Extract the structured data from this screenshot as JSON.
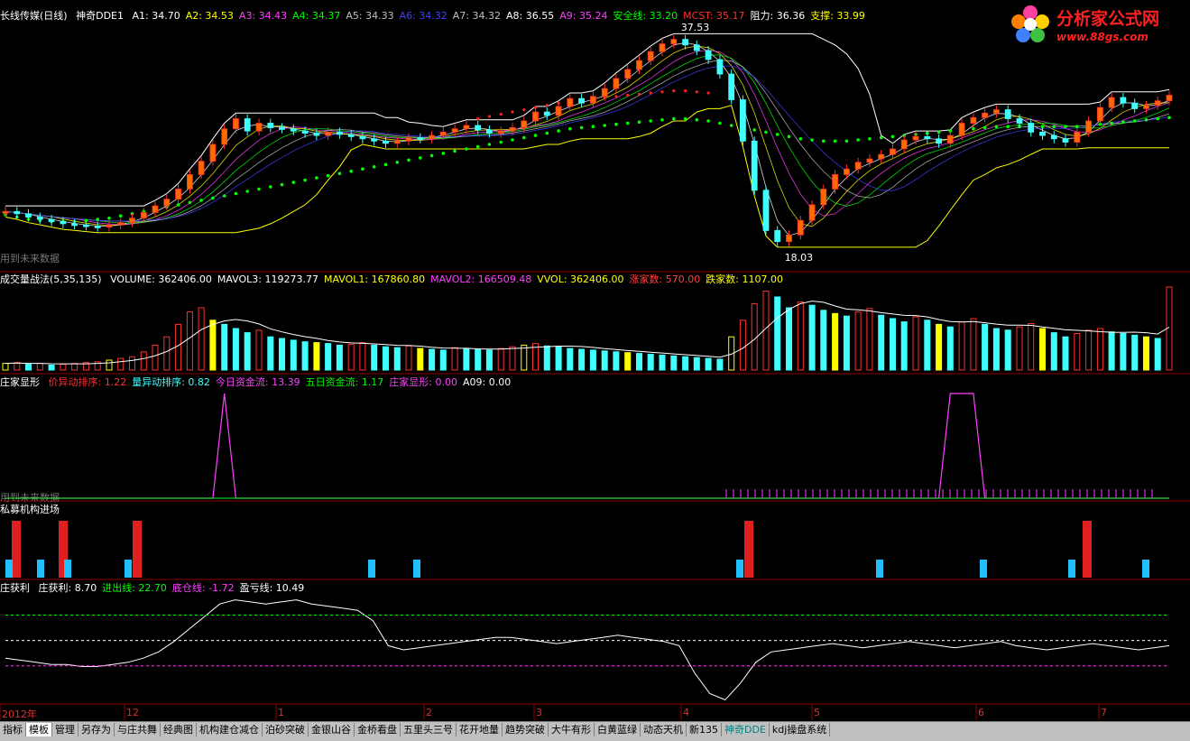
{
  "header": {
    "stock_name": "长线传媒(日线)",
    "indicator_name": "神奇DDE1",
    "items": [
      {
        "label": "A1: 34.70",
        "color": "#ffffff"
      },
      {
        "label": "A2: 34.53",
        "color": "#ffff00"
      },
      {
        "label": "A3: 34.43",
        "color": "#ff40ff"
      },
      {
        "label": "A4: 34.37",
        "color": "#00ff00"
      },
      {
        "label": "A5: 34.33",
        "color": "#c0c0c0"
      },
      {
        "label": "A6: 34.32",
        "color": "#4040ff"
      },
      {
        "label": "A7: 34.32",
        "color": "#c0c0c0"
      },
      {
        "label": "A8: 36.55",
        "color": "#ffffff"
      },
      {
        "label": "A9: 35.24",
        "color": "#ff40ff"
      },
      {
        "label": "安全线: 33.20",
        "color": "#00ff00"
      },
      {
        "label": "MCST: 35.17",
        "color": "#ff3030"
      },
      {
        "label": "阻力: 36.36",
        "color": "#ffffff"
      },
      {
        "label": "支撑: 33.99",
        "color": "#ffff00"
      }
    ]
  },
  "volume_header": {
    "title": "成交量战法(5,35,135)",
    "items": [
      {
        "label": "VOLUME: 362406.00",
        "color": "#ffffff"
      },
      {
        "label": "MAVOL3: 119273.77",
        "color": "#ffffff"
      },
      {
        "label": "MAVOL1: 167860.80",
        "color": "#ffff00"
      },
      {
        "label": "MAVOL2: 166509.48",
        "color": "#ff40ff"
      },
      {
        "label": "VVOL: 362406.00",
        "color": "#ffff00"
      },
      {
        "label": "涨家数: 570.00",
        "color": "#ff4040"
      },
      {
        "label": "跌家数: 1107.00",
        "color": "#ffff00"
      }
    ]
  },
  "dealer_header": {
    "title": "庄家显形",
    "items": [
      {
        "label": "价异动排序: 1.22",
        "color": "#ff3030"
      },
      {
        "label": "量异动排序: 0.82",
        "color": "#40ffff"
      },
      {
        "label": "今日资金流: 13.39",
        "color": "#ff40ff"
      },
      {
        "label": "五日资金流: 1.17",
        "color": "#00ff00"
      },
      {
        "label": "庄家显形: 0.00",
        "color": "#ff40ff"
      },
      {
        "label": "A09: 0.00",
        "color": "#ffffff"
      }
    ]
  },
  "fund_header": {
    "title": "私募机构进场"
  },
  "profit_header": {
    "title": "庄获利",
    "items": [
      {
        "label": "庄获利: 8.70",
        "color": "#ffffff"
      },
      {
        "label": "进出线: 22.70",
        "color": "#00ff00"
      },
      {
        "label": "底仓线: -1.72",
        "color": "#ff40ff"
      },
      {
        "label": "盈亏线: 10.49",
        "color": "#ffffff"
      }
    ]
  },
  "future_note": "用到未来数据",
  "price_labels": {
    "high": "37.53",
    "low": "18.03"
  },
  "time_axis": [
    "2012年",
    "12",
    "1",
    "2",
    "3",
    "4",
    "5",
    "6",
    "7"
  ],
  "watermark": {
    "title": "分析家公式网",
    "url": "www.88gs.com"
  },
  "tabs": [
    {
      "label": "指标",
      "active": false
    },
    {
      "label": "模板",
      "active": true
    },
    {
      "label": "管理",
      "active": false
    },
    {
      "label": "另存为",
      "active": false
    },
    {
      "label": "与庄共舞",
      "active": false
    },
    {
      "label": "经典图",
      "active": false
    },
    {
      "label": "机构建仓减仓",
      "active": false
    },
    {
      "label": "泊砂突破",
      "active": false
    },
    {
      "label": "金银山谷",
      "active": false
    },
    {
      "label": "金桥看盘",
      "active": false
    },
    {
      "label": "五里头三号",
      "active": false
    },
    {
      "label": "花开地量",
      "active": false
    },
    {
      "label": "趋势突破",
      "active": false
    },
    {
      "label": "大牛有形",
      "active": false
    },
    {
      "label": "白黄蓝绿",
      "active": false
    },
    {
      "label": "动态天机",
      "active": false
    },
    {
      "label": "新135",
      "active": false
    },
    {
      "label": "神奇DDE",
      "active": false,
      "teal": true
    },
    {
      "label": "kdj操盘系统",
      "active": false
    }
  ],
  "colors": {
    "up": "#ff3030",
    "down": "#40ffff",
    "ma": "#ffffff",
    "support": "#ffff00",
    "safe_dots": "#00ff00",
    "mcst_dots": "#ff2020",
    "separator": "#8b0000"
  },
  "chart_data": [
    {
      "type": "candlestick",
      "title": "长线传媒(日线) 神奇DDE1",
      "ylim": [
        17,
        38
      ],
      "annotations": [
        "37.53",
        "18.03"
      ],
      "series": [
        {
          "name": "close",
          "values": [
            21.5,
            21.3,
            21.0,
            20.8,
            20.6,
            20.4,
            20.3,
            20.2,
            20.1,
            20.3,
            20.5,
            20.9,
            21.4,
            22.0,
            22.6,
            23.5,
            24.8,
            26.0,
            27.5,
            28.9,
            29.8,
            28.7,
            29.4,
            29.0,
            28.9,
            28.7,
            28.5,
            28.3,
            28.6,
            28.4,
            28.2,
            28.0,
            27.8,
            27.6,
            27.8,
            28.1,
            28.0,
            28.3,
            28.6,
            28.9,
            29.2,
            28.8,
            28.5,
            28.7,
            29.0,
            29.6,
            30.4,
            30.1,
            30.9,
            31.6,
            31.2,
            31.8,
            32.5,
            33.4,
            34.2,
            35.0,
            35.8,
            36.5,
            36.9,
            36.4,
            35.9,
            35.1,
            33.8,
            31.5,
            27.8,
            23.4,
            19.8,
            18.8,
            19.4,
            20.7,
            22.1,
            23.5,
            24.8,
            25.3,
            25.9,
            26.2,
            26.6,
            27.1,
            27.9,
            28.2,
            28.0,
            27.6,
            28.3,
            29.4,
            29.9,
            30.3,
            30.6,
            29.8,
            29.4,
            28.6,
            28.3,
            28.0,
            27.7,
            28.6,
            29.6,
            30.8,
            31.7,
            31.2,
            30.7,
            31.0,
            31.4,
            31.9
          ]
        },
        {
          "name": "安全线",
          "values": [
            21.2,
            21.0,
            20.8,
            20.7,
            20.6,
            20.6,
            20.6,
            20.7,
            20.8,
            20.9,
            21.1,
            21.3,
            21.5,
            21.7,
            21.9,
            22.1,
            22.3,
            22.5,
            22.7,
            22.9,
            23.1,
            23.3,
            23.5,
            23.7,
            23.9,
            24.1,
            24.3,
            24.5,
            24.7,
            24.9,
            25.1,
            25.3,
            25.5,
            25.7,
            25.9,
            26.1,
            26.3,
            26.5,
            26.7,
            26.9,
            27.1,
            27.3,
            27.5,
            27.7,
            27.9,
            28.1,
            28.3,
            28.5,
            28.7,
            28.9,
            29.0,
            29.1,
            29.2,
            29.3,
            29.4,
            29.5,
            29.6,
            29.7,
            29.8,
            29.8,
            29.7,
            29.6,
            29.4,
            29.2,
            29.0,
            28.8,
            28.6,
            28.4,
            28.2,
            28.0,
            27.9,
            27.8,
            27.8,
            27.8,
            27.9,
            28.0,
            28.1,
            28.2,
            28.3,
            28.4,
            28.5,
            28.6,
            28.7,
            28.8,
            28.9,
            29.0,
            29.1,
            29.1,
            29.1,
            29.1,
            29.1,
            29.1,
            29.1,
            29.1,
            29.2,
            29.3,
            29.4,
            29.5,
            29.6,
            29.7,
            29.8,
            29.9
          ]
        }
      ]
    },
    {
      "type": "bar",
      "title": "成交量战法(5,35,135)",
      "series": [
        {
          "name": "VOLUME",
          "values": [
            8,
            9,
            7,
            8,
            6,
            7,
            8,
            9,
            10,
            12,
            14,
            16,
            22,
            30,
            40,
            55,
            70,
            75,
            60,
            55,
            50,
            45,
            48,
            40,
            38,
            36,
            34,
            33,
            32,
            30,
            31,
            33,
            30,
            28,
            27,
            29,
            26,
            25,
            24,
            27,
            26,
            25,
            24,
            26,
            28,
            30,
            32,
            29,
            28,
            26,
            25,
            24,
            23,
            22,
            21,
            20,
            19,
            18,
            17,
            16,
            15,
            14,
            13,
            40,
            60,
            80,
            95,
            88,
            75,
            82,
            78,
            72,
            68,
            65,
            70,
            74,
            66,
            62,
            58,
            64,
            60,
            55,
            52,
            58,
            62,
            55,
            50,
            48,
            52,
            56,
            50,
            45,
            40,
            44,
            48,
            50,
            46,
            44,
            42,
            40,
            38,
            100
          ]
        }
      ]
    },
    {
      "type": "line",
      "title": "庄家显形",
      "series": [
        {
          "name": "庄家显形",
          "values": [
            0,
            0,
            0,
            0,
            0,
            0,
            0,
            0,
            0,
            0,
            0,
            0,
            0,
            0,
            0,
            0,
            0,
            0,
            0,
            100,
            0,
            0,
            0,
            0,
            0,
            0,
            0,
            0,
            0,
            0,
            0,
            0,
            0,
            0,
            0,
            0,
            0,
            0,
            0,
            0,
            0,
            0,
            0,
            0,
            0,
            0,
            0,
            0,
            0,
            0,
            0,
            0,
            0,
            0,
            0,
            0,
            0,
            0,
            0,
            0,
            0,
            0,
            0,
            0,
            0,
            0,
            0,
            0,
            0,
            0,
            0,
            0,
            0,
            0,
            0,
            0,
            0,
            0,
            0,
            0,
            0,
            0,
            100,
            100,
            100,
            0,
            0,
            0,
            0,
            0,
            0,
            0,
            0,
            0,
            0,
            0,
            0,
            0,
            0,
            0,
            0,
            0
          ]
        }
      ]
    },
    {
      "type": "bar",
      "title": "私募机构进场",
      "series": [
        {
          "name": "red",
          "values": [
            1,
            0,
            1,
            0,
            1,
            0,
            0,
            1,
            0,
            0,
            0,
            0,
            1,
            1
          ]
        },
        {
          "name": "blue",
          "values": [
            1,
            1,
            1,
            1,
            1,
            1,
            1,
            1,
            1,
            1,
            1,
            1,
            1,
            1
          ]
        }
      ]
    },
    {
      "type": "line",
      "title": "庄获利",
      "series": [
        {
          "name": "庄获利",
          "values": [
            2,
            1,
            0,
            -1,
            -1,
            -2,
            -2,
            -1,
            0,
            2,
            5,
            10,
            16,
            22,
            28,
            30,
            29,
            28,
            29,
            30,
            28,
            27,
            26,
            25,
            20,
            8,
            6,
            7,
            8,
            9,
            10,
            11,
            12,
            12,
            11,
            10,
            9,
            10,
            11,
            12,
            13,
            12,
            11,
            10,
            8,
            -5,
            -15,
            -18,
            -10,
            0,
            5,
            6,
            7,
            8,
            9,
            8,
            7,
            8,
            9,
            10,
            9,
            8,
            7,
            8,
            9,
            10,
            8,
            7,
            6,
            7,
            8,
            9,
            8,
            7,
            6,
            7,
            8
          ]
        },
        {
          "name": "进出线",
          "values": [
            22.7
          ]
        },
        {
          "name": "底仓线",
          "values": [
            -1.72
          ]
        },
        {
          "name": "盈亏线",
          "values": [
            10.49
          ]
        }
      ]
    }
  ]
}
